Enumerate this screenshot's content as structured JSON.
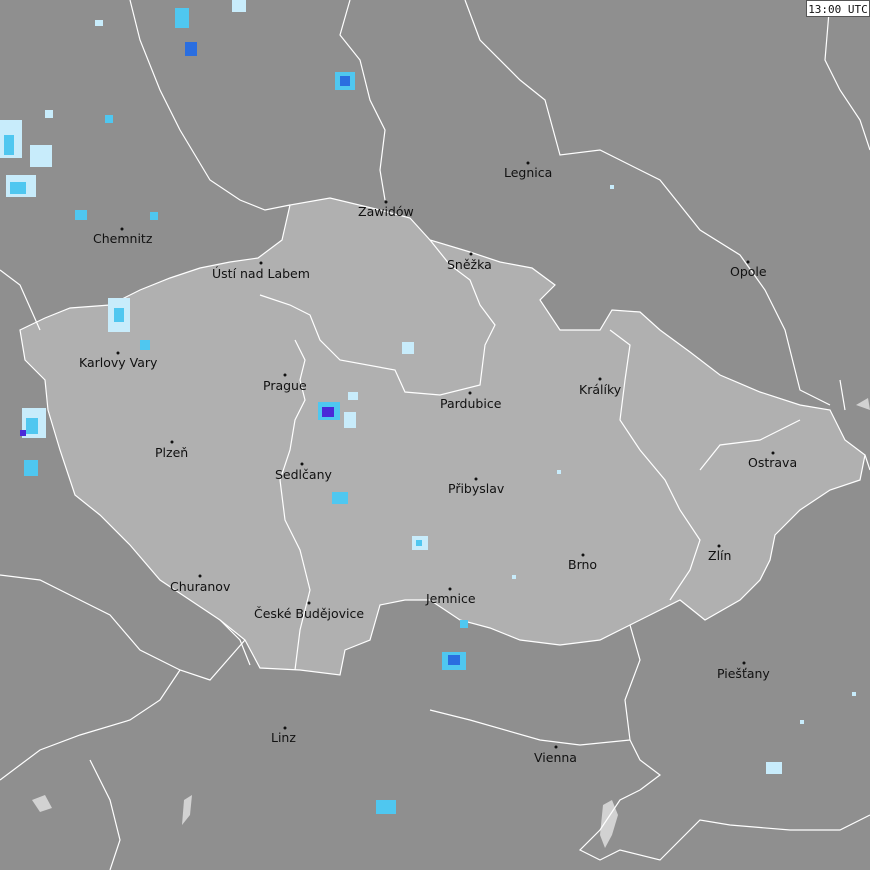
{
  "timestamp": "13:00 UTC",
  "colors": {
    "background": "#8f8f8f",
    "country_fill": "#b0b0b0",
    "border_line": "#ffffff",
    "water": "#d2d2d2",
    "precip_light": "#c8ecfb",
    "precip_medium": "#4fc7f0",
    "precip_heavy": "#2a6ee0",
    "precip_intense": "#4a2ad8"
  },
  "cities": [
    {
      "id": "legnica",
      "name": "Legnica"
    },
    {
      "id": "zawidow",
      "name": "Zawidów"
    },
    {
      "id": "chemnitz",
      "name": "Chemnitz"
    },
    {
      "id": "usti",
      "name": "Ústí nad Labem"
    },
    {
      "id": "snezka",
      "name": "Sněžka"
    },
    {
      "id": "opole",
      "name": "Opole"
    },
    {
      "id": "karlovy-vary",
      "name": "Karlovy Vary"
    },
    {
      "id": "prague",
      "name": "Prague"
    },
    {
      "id": "kraliky",
      "name": "Králíky"
    },
    {
      "id": "pardubice",
      "name": "Pardubice"
    },
    {
      "id": "plzen",
      "name": "Plzeň"
    },
    {
      "id": "ostrava",
      "name": "Ostrava"
    },
    {
      "id": "sedlcany",
      "name": "Sedlčany"
    },
    {
      "id": "pribyslav",
      "name": "Přibyslav"
    },
    {
      "id": "zlin",
      "name": "Zlín"
    },
    {
      "id": "brno",
      "name": "Brno"
    },
    {
      "id": "churanov",
      "name": "Churanov"
    },
    {
      "id": "jemnice",
      "name": "Jemnice"
    },
    {
      "id": "budejovice",
      "name": "České Budějovice"
    },
    {
      "id": "piestany",
      "name": "Piešťany"
    },
    {
      "id": "linz",
      "name": "Linz"
    },
    {
      "id": "vienna",
      "name": "Vienna"
    }
  ]
}
